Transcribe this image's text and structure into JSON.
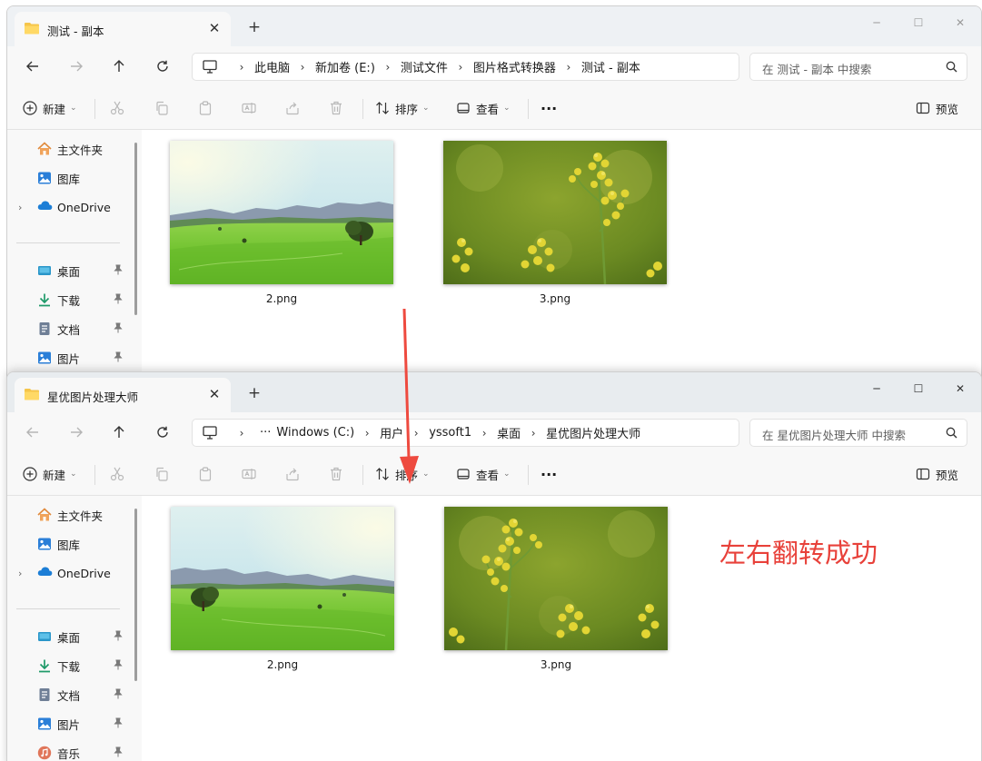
{
  "window_top": {
    "tab_title": "测试 - 副本",
    "breadcrumbs": [
      "此电脑",
      "新加卷 (E:)",
      "测试文件",
      "图片格式转换器",
      "测试 - 副本"
    ],
    "search_placeholder": "在 测试 - 副本 中搜索",
    "files": [
      "2.png",
      "3.png"
    ]
  },
  "window_bottom": {
    "tab_title": "星优图片处理大师",
    "breadcrumbs": [
      "Windows (C:)",
      "用户",
      "yssoft1",
      "桌面",
      "星优图片处理大师"
    ],
    "search_placeholder": "在 星优图片处理大师 中搜索",
    "files": [
      "2.png",
      "3.png"
    ]
  },
  "toolbar": {
    "new_label": "新建",
    "sort_label": "排序",
    "view_label": "查看",
    "more_label": "···",
    "preview_label": "预览"
  },
  "sidebar": {
    "home": "主文件夹",
    "gallery": "图库",
    "onedrive": "OneDrive",
    "desktop": "桌面",
    "downloads": "下载",
    "documents": "文档",
    "pictures": "图片",
    "music": "音乐"
  },
  "annotation": "左右翻转成功",
  "colors": {
    "annotation": "#e8413a",
    "arrow": "#ee4a3f",
    "folder": "#f5c54b"
  }
}
